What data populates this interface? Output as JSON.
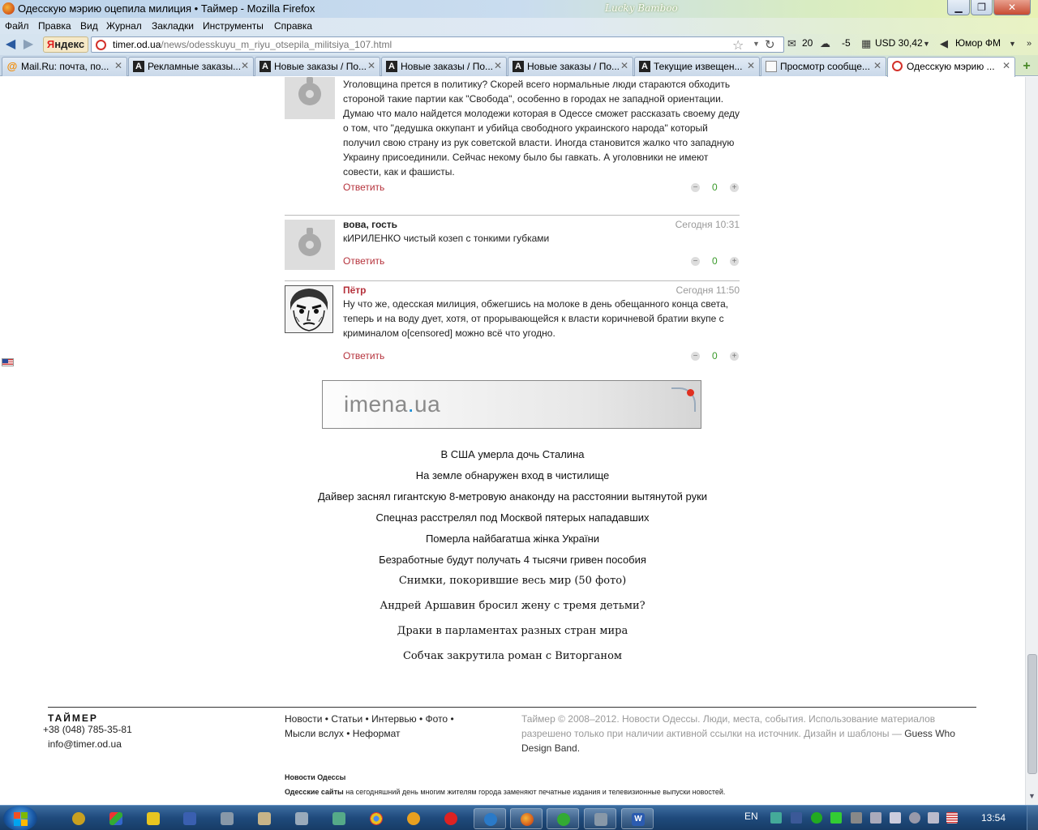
{
  "window": {
    "title": "Одесскую мэрию оцепила милиция • Таймер - Mozilla Firefox",
    "theme_name": "Lucky Bamboo",
    "min_icon": "minimize-icon",
    "max_icon": "maximize-icon",
    "close_icon": "close-icon"
  },
  "menu": [
    "Файл",
    "Правка",
    "Вид",
    "Журнал",
    "Закладки",
    "Инструменты",
    "Справка"
  ],
  "nav": {
    "yandex_ya": "Я",
    "yandex_rest": "ндекс",
    "url_host": "timer.od.ua",
    "url_path": "/news/odesskuyu_m_riyu_otsepila_militsiya_107.html",
    "mail_count": "20",
    "weather": "-5",
    "currency": "USD 30,42",
    "radio": "Юмор ФМ"
  },
  "tabs": [
    {
      "label": "Mail.Ru: почта, по...",
      "icon": "mail-icon"
    },
    {
      "label": "Рекламные заказы...",
      "icon": "a-icon"
    },
    {
      "label": "Новые заказы / По...",
      "icon": "a-icon"
    },
    {
      "label": "Новые заказы / По...",
      "icon": "a-icon"
    },
    {
      "label": "Новые заказы / По...",
      "icon": "a-icon"
    },
    {
      "label": "Текущие извещен...",
      "icon": "a-icon"
    },
    {
      "label": "Просмотр сообще...",
      "icon": "message-icon"
    },
    {
      "label": "Одесскую мэрию ...",
      "icon": "timer-icon",
      "active": true
    }
  ],
  "comments": [
    {
      "author": "",
      "time": "",
      "text": "Уголовщина прется в политику? Скорей всего нормальные люди стараются обходить стороной такие партии как \"Свобода\", особенно в городах не западной ориентации. Думаю что мало найдется молодежи которая в Одессе сможет рассказать своему деду о том, что \"дедушка оккупант и убийца свободного украинского народа\" который получил свою страну из рук советской власти. Иногда становится жалко что западную Украину присоединили. Сейчас некому было бы гавкать. А уголовники не имеют совести, как и фашисты.",
      "reply": "Ответить",
      "score": "0"
    },
    {
      "author": "вова, гость",
      "time": "Сегодня 10:31",
      "text": "кИРИЛЕНКО чистый козеп с тонкими губками",
      "reply": "Ответить",
      "score": "0"
    },
    {
      "author": "Пётр",
      "time": "Сегодня 11:50",
      "text": "Ну что же, одесская милиция, обжегшись на молоке в день обещанного конца света, теперь и на воду дует, хотя, от прорывающейся к власти коричневой братии вкупе с криминалом о[censored] можно всё что угодно.",
      "reply": "Ответить",
      "score": "0"
    }
  ],
  "banner": {
    "logo_a": "imena",
    "logo_dot": ".",
    "logo_b": "ua"
  },
  "promo_links": [
    "В США умерла дочь Сталина",
    "На земле обнаружен вход в чистилище",
    "Дайвер заснял гигантскую 8-метровую анаконду на расстоянии вытянутой руки",
    "Спецназ расстрелял под Москвой пятерых нападавших",
    "Померла найбагатша жінка України",
    "Безработные будут получать 4 тысячи гривен пособия",
    "Снимки, покорившие весь мир (50 фото)",
    "Андрей Аршавин бросил жену с тремя детьми?",
    "Драки в парламентах разных стран мира",
    "Собчак закрутила роман с Виторганом"
  ],
  "footer": {
    "logo": "ТАЙМЕР",
    "phone": "+38 (048) 785-35-81",
    "email": "info@timer.od.ua",
    "nav_line1": "Новости • Статьи • Интервью • Фото •",
    "nav_line2": "Мысли вслух • Неформат",
    "copyright": "Таймер © 2008–2012. Новости Одессы. Люди, места, события. Использование материалов разрешено только при наличии активной ссылки на источник. Дизайн и шаблоны —",
    "credit": "Guess Who Design Band",
    "credit_end": ".",
    "seo_title": "Новости Одессы",
    "seo_bold": "Одесские сайты",
    "seo_text": " на сегодняшний день многим жителям города заменяют печатные издания и телевизионные выпуски новостей."
  },
  "taskbar": {
    "lang": "EN",
    "clock": "13:54"
  }
}
